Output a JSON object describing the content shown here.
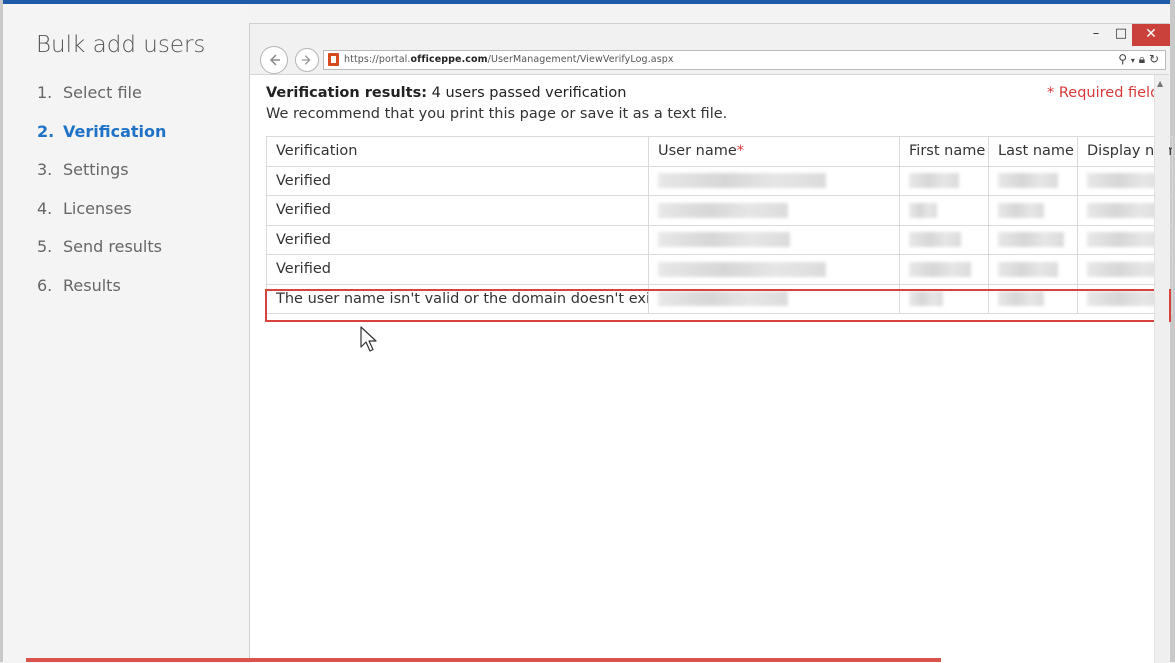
{
  "wizard": {
    "title": "Bulk add users",
    "steps": [
      {
        "num": "1.",
        "label": "Select file"
      },
      {
        "num": "2.",
        "label": "Verification"
      },
      {
        "num": "3.",
        "label": "Settings"
      },
      {
        "num": "4.",
        "label": "Licenses"
      },
      {
        "num": "5.",
        "label": "Send results"
      },
      {
        "num": "6.",
        "label": "Results"
      }
    ],
    "active_step": 2
  },
  "browser": {
    "url_prefix": "https://portal.",
    "url_domain": "officeppe.com",
    "url_path": "/UserManagement/ViewVerifyLog.aspx",
    "controls": {
      "minimize": "–",
      "maximize": "□",
      "close": "✕"
    }
  },
  "page": {
    "verification_label": "Verification results:",
    "verification_summary": "4 users passed verification",
    "recommendation": "We recommend that you print this page or save it as a text file.",
    "required_note": "* Required fields"
  },
  "table": {
    "headers": {
      "verification": "Verification",
      "user_name": "User name",
      "user_name_marker": "*",
      "first_name": "First name",
      "last_name": "Last name",
      "display_name": "Display nam"
    },
    "rows": [
      {
        "verification": "Verified"
      },
      {
        "verification": "Verified"
      },
      {
        "verification": "Verified"
      },
      {
        "verification": "Verified"
      },
      {
        "verification": "The user name isn't valid or the domain doesn't exist."
      }
    ]
  },
  "colors": {
    "active_step": "#1e72c7",
    "required": "#d7393a",
    "highlight_border": "#d8423f",
    "close_button": "#c9413a"
  }
}
